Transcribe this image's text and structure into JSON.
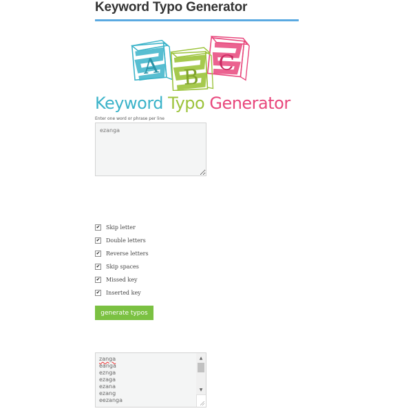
{
  "page": {
    "title": "Keyword Typo Generator"
  },
  "logo": {
    "blocks": [
      "A",
      "B",
      "C"
    ],
    "text_part1": "Keyword",
    "text_part2": "Typo",
    "text_part3": "Generator",
    "colors": {
      "blue": "#3bb3c9",
      "green": "#9cc33b",
      "pink": "#e8477c"
    }
  },
  "input": {
    "label": "Enter one word or phrase per line",
    "value": "ezanga"
  },
  "options": [
    {
      "label": "Skip letter",
      "checked": true
    },
    {
      "label": "Double letters",
      "checked": true
    },
    {
      "label": "Reverse letters",
      "checked": true
    },
    {
      "label": "Skip spaces",
      "checked": true
    },
    {
      "label": "Missed key",
      "checked": true
    },
    {
      "label": "Inserted key",
      "checked": true
    }
  ],
  "generate_button": {
    "label": "generate typos",
    "color": "#7bc142"
  },
  "results": {
    "lines": [
      "zanga",
      "eanga",
      "eznga",
      "ezaga",
      "ezana",
      "ezang",
      "eezanga"
    ]
  },
  "accent_color": "#5aa9e1"
}
